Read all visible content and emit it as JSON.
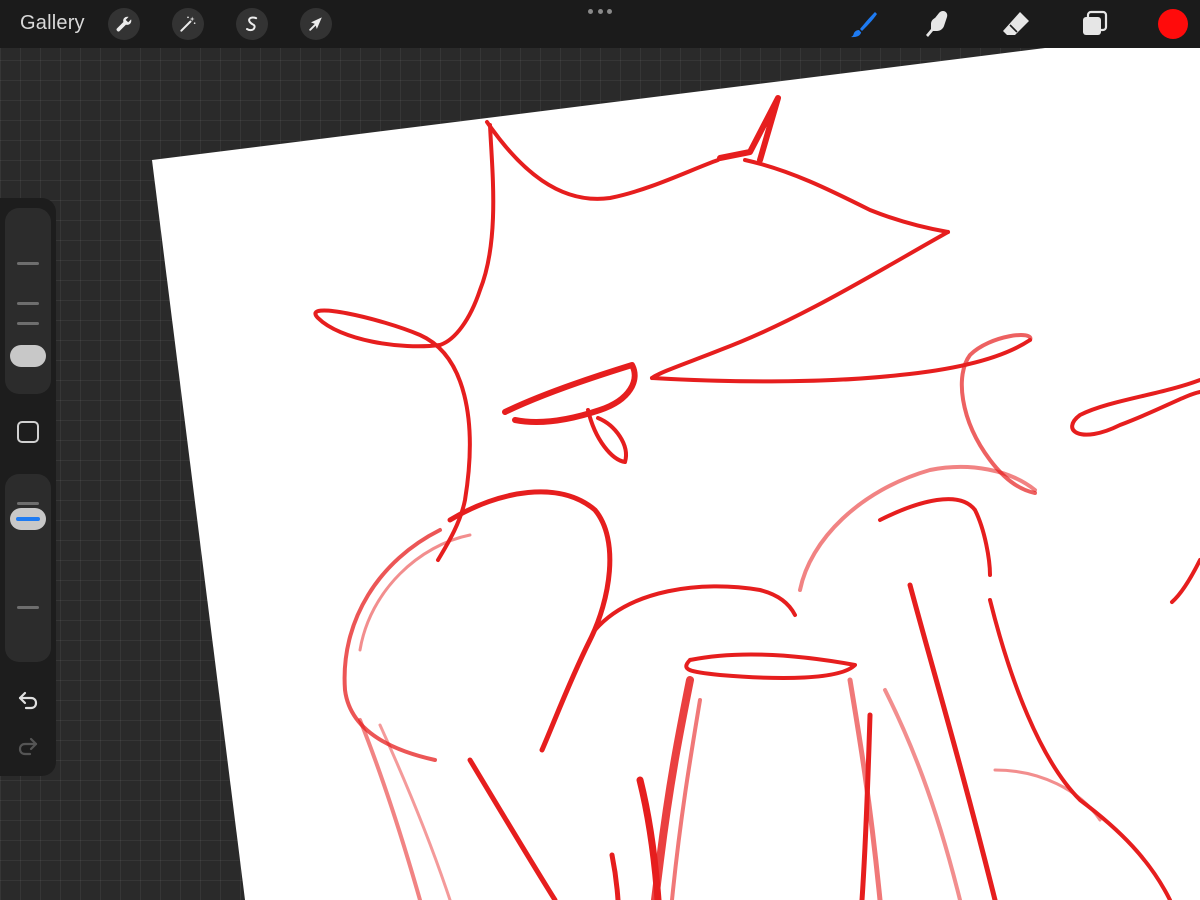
{
  "topbar": {
    "gallery_label": "Gallery",
    "left_tools": [
      {
        "name": "actions",
        "icon": "wrench-icon"
      },
      {
        "name": "adjustments",
        "icon": "magic-wand-icon"
      },
      {
        "name": "selection",
        "icon": "s-curve-icon"
      },
      {
        "name": "transform",
        "icon": "arrow-cursor-icon"
      }
    ],
    "right_tools": [
      {
        "name": "brush",
        "icon": "paintbrush-icon",
        "active": true
      },
      {
        "name": "smudge",
        "icon": "smudge-finger-icon",
        "active": false
      },
      {
        "name": "eraser",
        "icon": "eraser-icon",
        "active": false
      },
      {
        "name": "layers",
        "icon": "layers-icon",
        "active": false
      }
    ],
    "current_color": "#ff0b0b",
    "active_tool_color": "#1e7bf2"
  },
  "sidebar": {
    "brush_size_slider": {
      "icon": "size-slider"
    },
    "modify_button": {
      "icon": "square-icon"
    },
    "opacity_slider": {
      "icon": "opacity-slider"
    },
    "undo": {
      "icon": "undo-icon"
    },
    "redo": {
      "icon": "redo-icon",
      "enabled": false
    }
  },
  "canvas": {
    "background": "#ffffff",
    "stroke_color": "#e61e1e",
    "workspace_color": "#2a2a2a"
  }
}
